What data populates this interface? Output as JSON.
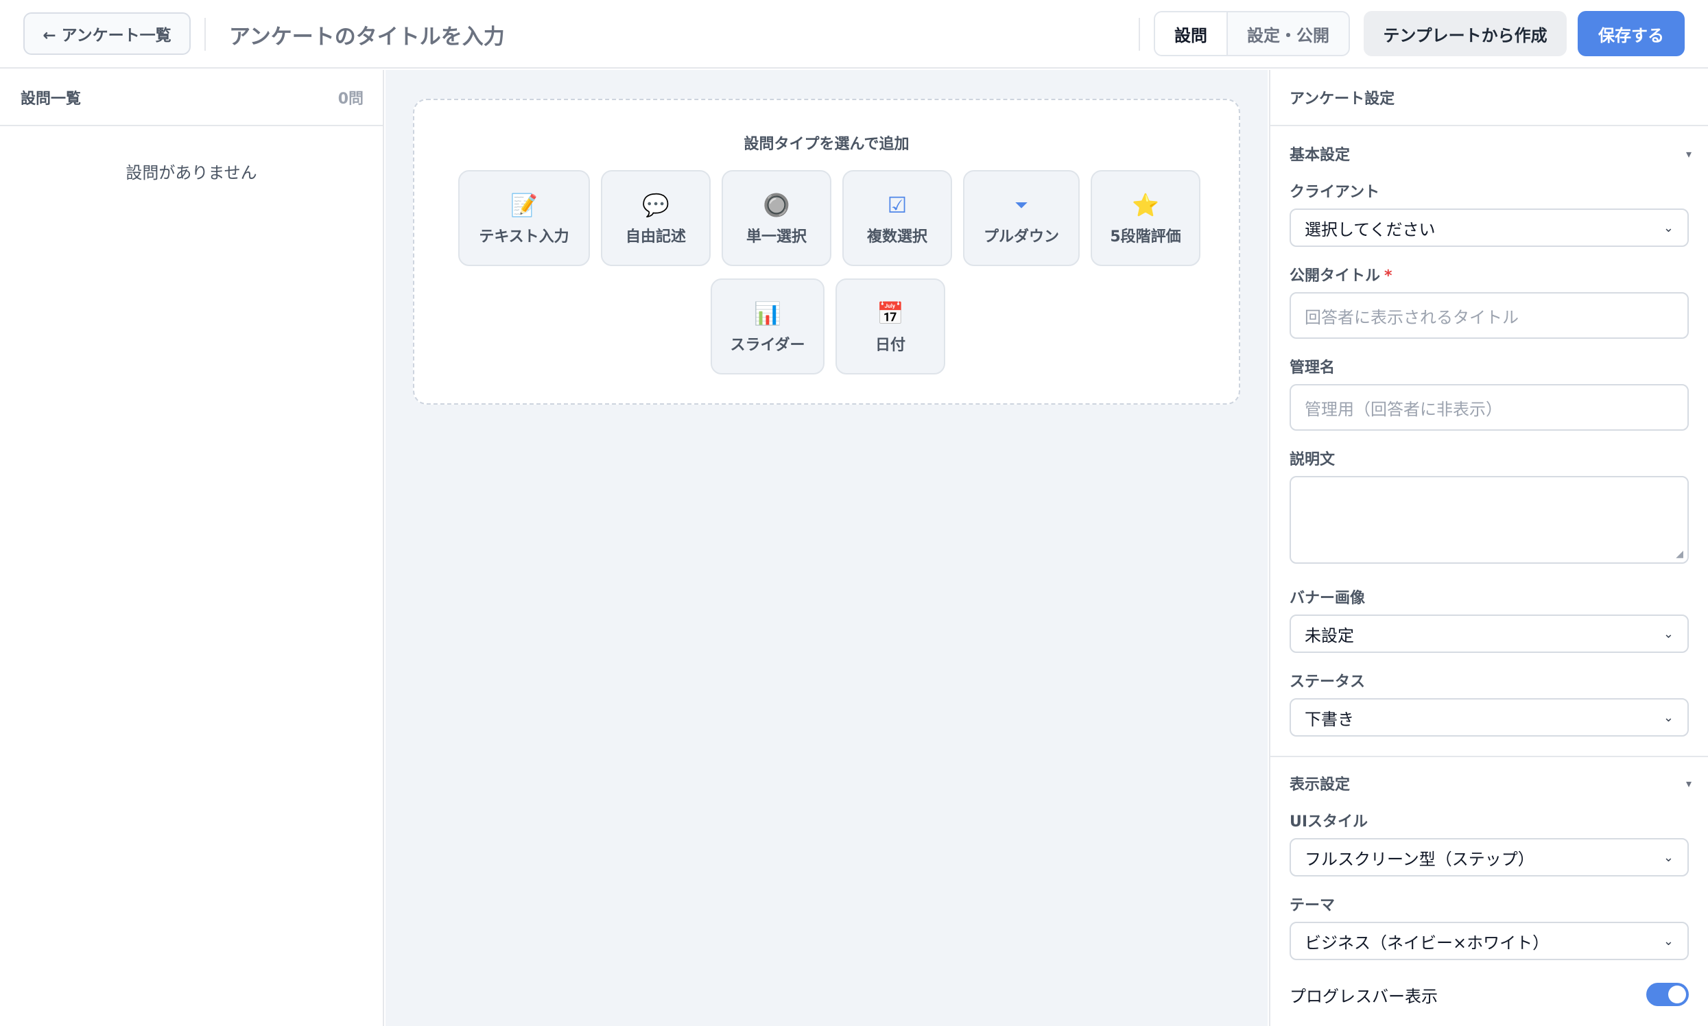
{
  "header": {
    "back_label": "← アンケート一覧",
    "title_placeholder": "アンケートのタイトルを入力",
    "tabs": [
      {
        "label": "設問",
        "active": true
      },
      {
        "label": "設定・公開",
        "active": false
      }
    ],
    "template_label": "テンプレートから作成",
    "save_label": "保存する"
  },
  "left": {
    "heading": "設問一覧",
    "count": "0問",
    "empty_message": "設問がありません"
  },
  "center": {
    "heading": "設問タイプを選んで追加",
    "types": [
      {
        "icon": "📝",
        "icon_name": "memo-icon",
        "label": "テキスト入力"
      },
      {
        "icon": "💬",
        "icon_name": "speech-bubble-icon",
        "label": "自由記述"
      },
      {
        "icon": "🔘",
        "icon_name": "radio-button-icon",
        "label": "単一選択"
      },
      {
        "icon": "☑",
        "icon_name": "checkbox-icon",
        "label": "複数選択"
      },
      {
        "icon": "⏷",
        "icon_name": "dropdown-triangle-icon",
        "label": "プルダウン"
      },
      {
        "icon": "⭐",
        "icon_name": "star-icon",
        "label": "5段階評価"
      },
      {
        "icon": "📊",
        "icon_name": "bar-chart-icon",
        "label": "スライダー"
      },
      {
        "icon": "📅",
        "icon_name": "calendar-icon",
        "label": "日付"
      }
    ]
  },
  "right": {
    "heading": "アンケート設定",
    "basic": {
      "title": "基本設定",
      "client_label": "クライアント",
      "client_value": "選択してください",
      "public_title_label": "公開タイトル",
      "public_title_required": "*",
      "public_title_placeholder": "回答者に表示されるタイトル",
      "admin_name_label": "管理名",
      "admin_name_placeholder": "管理用（回答者に非表示）",
      "description_label": "説明文",
      "banner_label": "バナー画像",
      "banner_value": "未設定",
      "status_label": "ステータス",
      "status_value": "下書き"
    },
    "display": {
      "title": "表示設定",
      "ui_style_label": "UIスタイル",
      "ui_style_value": "フルスクリーン型（ステップ）",
      "theme_label": "テーマ",
      "theme_value": "ビジネス（ネイビー×ホワイト）",
      "progress_label": "プログレスバー表示",
      "progress_on": true
    }
  },
  "colors": {
    "accent": "#4f86e8",
    "canvas_bg": "#f1f4f8",
    "required": "#e53e3e"
  }
}
